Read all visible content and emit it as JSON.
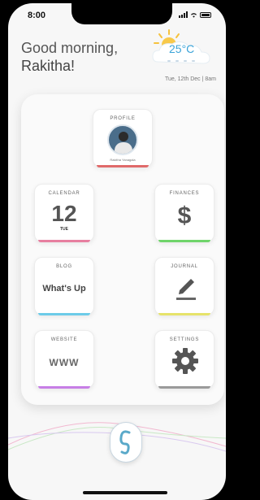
{
  "status_bar": {
    "time": "8:00"
  },
  "header": {
    "greeting": "Good morning,",
    "username": "Rakitha!",
    "temperature": "25°C",
    "date": "Tue, 12th Dec | 8am"
  },
  "tiles": {
    "profile": {
      "title": "PROFILE",
      "caption": "Rakitha Yanagala",
      "accent": "#e06a6a"
    },
    "calendar": {
      "title": "CALENDAR",
      "day_number": "12",
      "day_name": "TUE",
      "accent": "#e77fa0"
    },
    "finances": {
      "title": "FINANCES",
      "symbol": "$",
      "accent": "#6fd46a"
    },
    "blog": {
      "title": "BLOG",
      "text": "What's Up",
      "accent": "#6ccbe8"
    },
    "journal": {
      "title": "JOURNAL",
      "icon": "pencil-icon",
      "accent": "#e6e36a"
    },
    "website": {
      "title": "WEBSITE",
      "text": "WWW",
      "accent": "#c77ee6"
    },
    "settings": {
      "title": "SETTINGS",
      "icon": "gear-icon",
      "accent": "#9a9a9a"
    }
  },
  "bottom": {
    "icon": "app-logo-icon"
  }
}
